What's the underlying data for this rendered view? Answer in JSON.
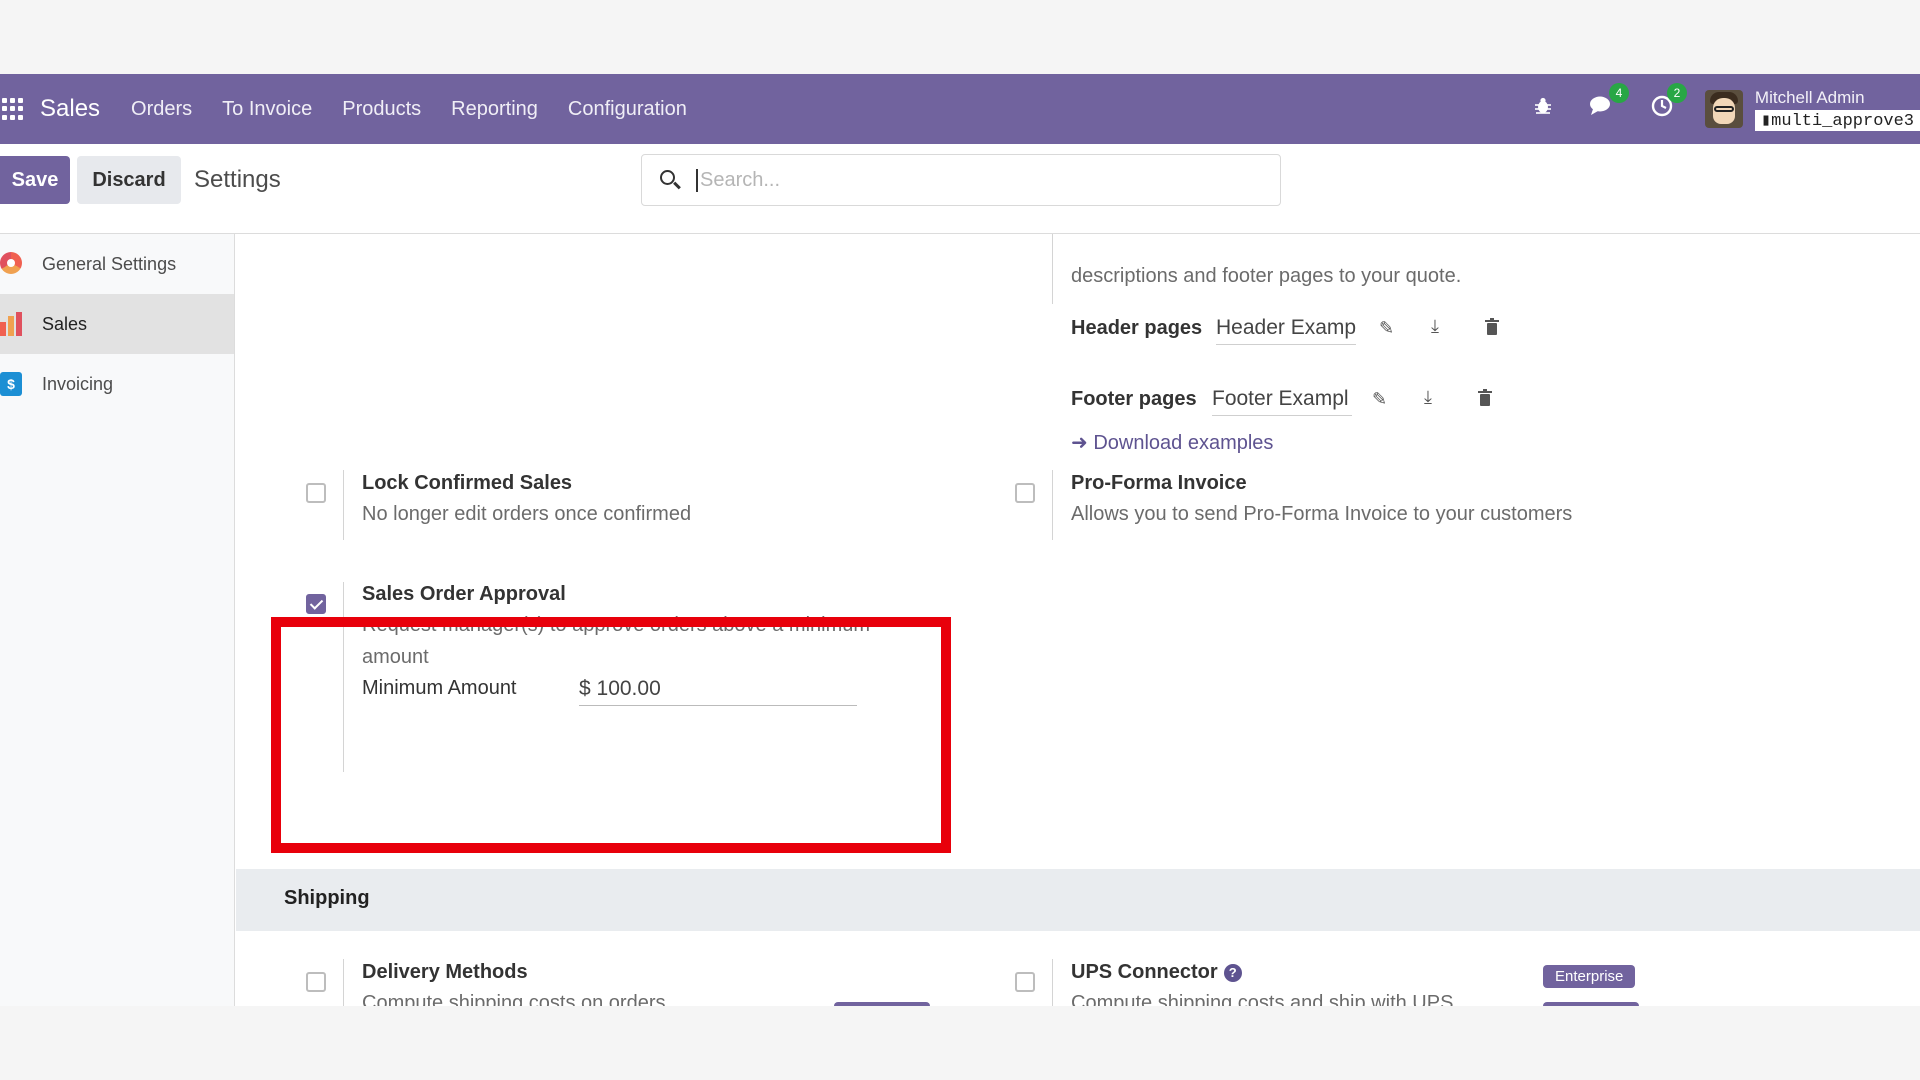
{
  "navbar": {
    "brand": "Sales",
    "menu": [
      "Orders",
      "To Invoice",
      "Products",
      "Reporting",
      "Configuration"
    ],
    "messages_count": "4",
    "activities_count": "2",
    "user_name": "Mitchell Admin",
    "database": "multi_approve3"
  },
  "control": {
    "save_label": "Save",
    "discard_label": "Discard",
    "breadcrumb": "Settings",
    "search_placeholder": "Search..."
  },
  "sidebar": {
    "items": [
      {
        "label": "General Settings",
        "icon": "general-settings-icon"
      },
      {
        "label": "Sales",
        "icon": "sales-app-icon",
        "active": true
      },
      {
        "label": "Invoicing",
        "icon": "invoicing-app-icon"
      }
    ]
  },
  "quotation_builder": {
    "desc_tail": "descriptions and footer pages to your quote.",
    "header_label": "Header pages",
    "header_value": "Header Examp",
    "footer_label": "Footer pages",
    "footer_value": "Footer Exampl",
    "download_link": "Download examples"
  },
  "settings": {
    "lock": {
      "title": "Lock Confirmed Sales",
      "desc": "No longer edit orders once confirmed",
      "checked": false
    },
    "proforma": {
      "title": "Pro-Forma Invoice",
      "desc": "Allows you to send Pro-Forma Invoice to your customers",
      "checked": false
    },
    "approval": {
      "title": "Sales Order Approval",
      "desc": "Request manager(s) to approve orders above a minimum amount",
      "checked": true,
      "min_label": "Minimum Amount",
      "min_value": "$ 100.00"
    }
  },
  "shipping": {
    "section_title": "Shipping",
    "delivery": {
      "title": "Delivery Methods",
      "desc": "Compute shipping costs on orders",
      "checked": false
    },
    "ups": {
      "title": "UPS Connector",
      "desc": "Compute shipping costs and ship with UPS",
      "checked": false,
      "badge": "Enterprise"
    }
  },
  "colors": {
    "brand": "#71639e",
    "highlight_box": "#e8000b",
    "badge_green": "#28a745"
  }
}
